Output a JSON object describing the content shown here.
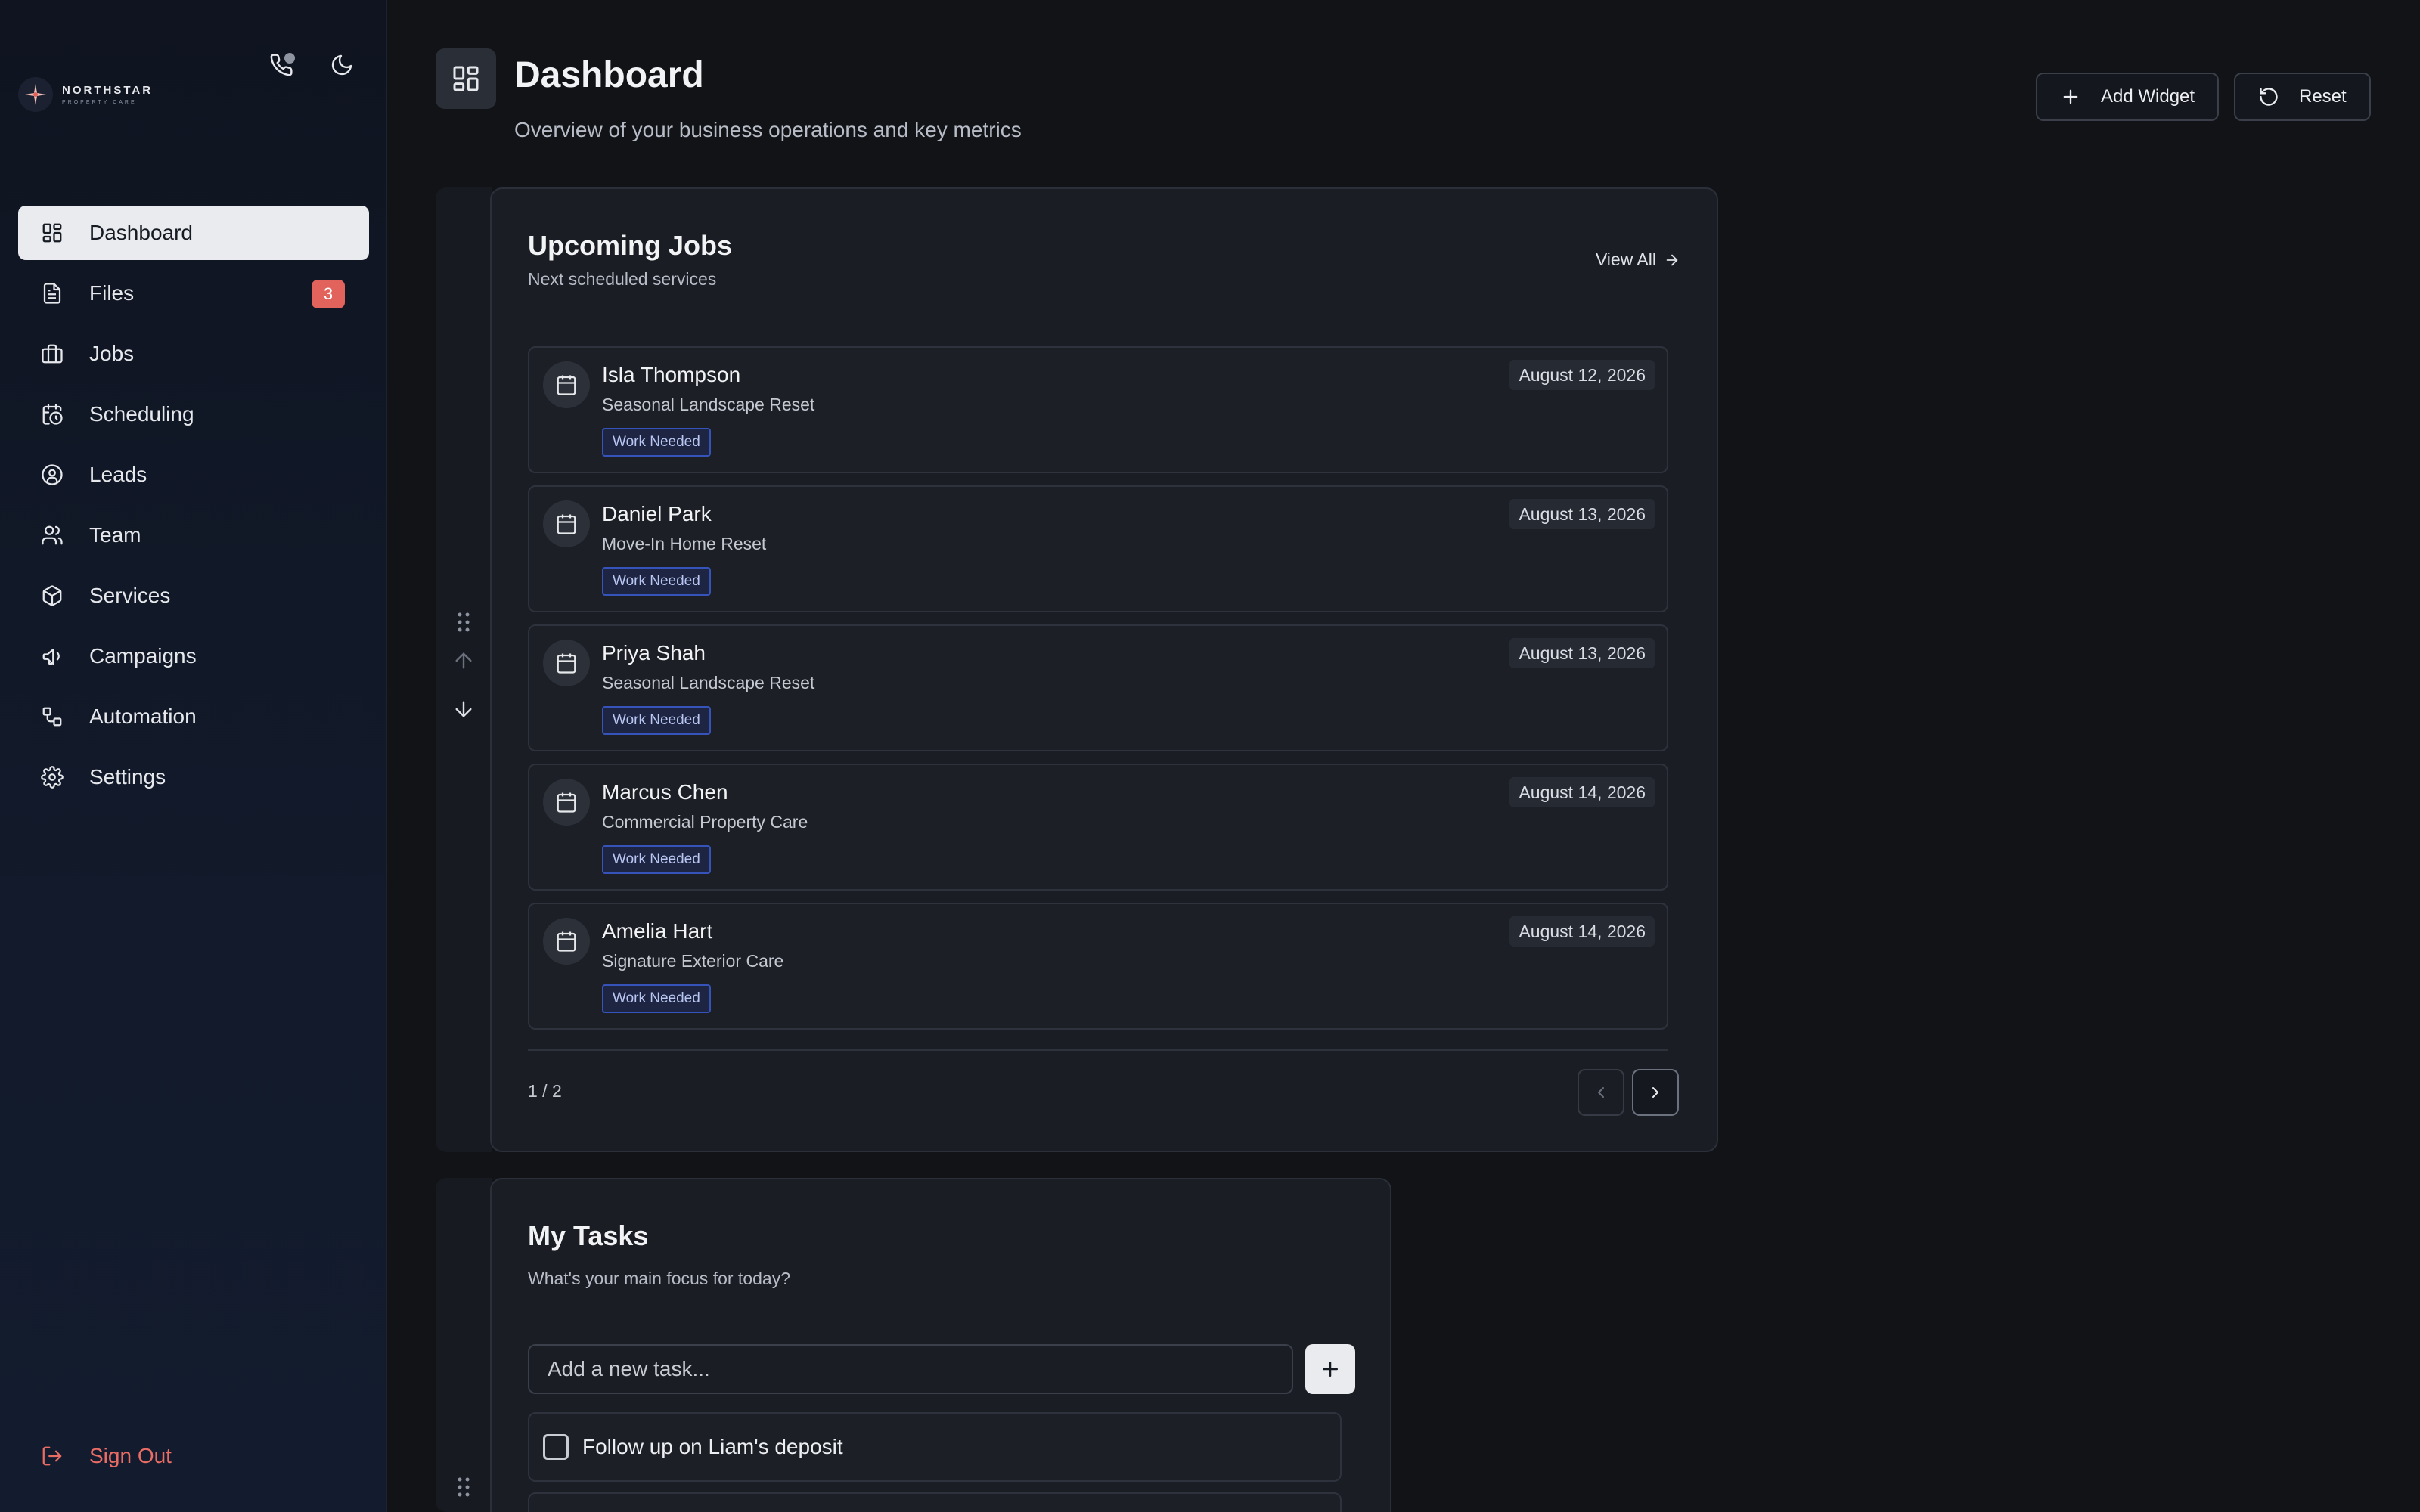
{
  "brand": {
    "name": "NORTHSTAR",
    "tagline": "PROPERTY CARE"
  },
  "top_icons": [
    "phone-icon",
    "moon-icon"
  ],
  "nav": [
    {
      "label": "Dashboard",
      "icon": "dashboard-icon",
      "active": true
    },
    {
      "label": "Files",
      "icon": "file-icon",
      "badge": "3"
    },
    {
      "label": "Jobs",
      "icon": "briefcase-icon"
    },
    {
      "label": "Scheduling",
      "icon": "calendar-clock-icon"
    },
    {
      "label": "Leads",
      "icon": "user-circle-icon"
    },
    {
      "label": "Team",
      "icon": "users-icon"
    },
    {
      "label": "Services",
      "icon": "box-icon"
    },
    {
      "label": "Campaigns",
      "icon": "megaphone-icon"
    },
    {
      "label": "Automation",
      "icon": "workflow-icon"
    },
    {
      "label": "Settings",
      "icon": "gear-icon"
    }
  ],
  "sign_out": "Sign Out",
  "header": {
    "title": "Dashboard",
    "subtitle": "Overview of your business operations and key metrics",
    "add_widget": "Add Widget",
    "reset": "Reset"
  },
  "upcoming_jobs": {
    "title": "Upcoming Jobs",
    "subtitle": "Next scheduled services",
    "view_all": "View All",
    "jobs": [
      {
        "name": "Isla Thompson",
        "service": "Seasonal Landscape Reset",
        "status": "Work Needed",
        "date": "August 12, 2026"
      },
      {
        "name": "Daniel Park",
        "service": "Move-In Home Reset",
        "status": "Work Needed",
        "date": "August 13, 2026"
      },
      {
        "name": "Priya Shah",
        "service": "Seasonal Landscape Reset",
        "status": "Work Needed",
        "date": "August 13, 2026"
      },
      {
        "name": "Marcus Chen",
        "service": "Commercial Property Care",
        "status": "Work Needed",
        "date": "August 14, 2026"
      },
      {
        "name": "Amelia Hart",
        "service": "Signature Exterior Care",
        "status": "Work Needed",
        "date": "August 14, 2026"
      }
    ],
    "page": "1 / 2"
  },
  "my_tasks": {
    "title": "My Tasks",
    "subtitle": "What's your main focus for today?",
    "placeholder": "Add a new task...",
    "tasks": [
      {
        "label": "Follow up on Liam's deposit",
        "done": false
      }
    ]
  },
  "colors": {
    "accent_badge": "#e2625c",
    "sign_out": "#e96d64",
    "tag_border": "#3553b8"
  }
}
